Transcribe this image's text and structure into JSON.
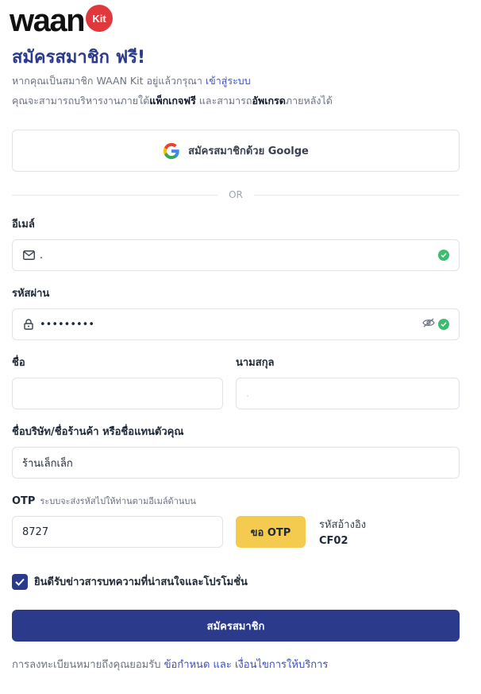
{
  "brand": {
    "wordmark": "waan",
    "badge": "Kit",
    "badge_color": "#e0383c"
  },
  "colors": {
    "primary": "#2b3a8a",
    "link": "#3b4ec4",
    "otp_button": "#f4cb4e",
    "success": "#3ebc6e"
  },
  "header": {
    "title": "สมัครสมาชิก ฟรี!",
    "line1_prefix": "หากคุณเป็นสมาชิก WAAN Kit อยู่แล้วกรุณา ",
    "line1_link": "เข้าสู่ระบบ",
    "line2_a": "คุณจะสามารถบริหารงานภายใต้",
    "line2_b": "แพ็กเกจฟรี",
    "line2_c": " และสามารถ",
    "line2_d": "อัพเกรด",
    "line2_e": "ภายหลังได้"
  },
  "google_button": {
    "label": "สมัครสมาชิกด้วย Goolge",
    "icon": "google-icon"
  },
  "divider_text": "OR",
  "email": {
    "label": "อีเมล์",
    "value": ".",
    "icon": "mail-icon",
    "valid": true
  },
  "password": {
    "label": "รหัสผ่าน",
    "value": "•••••••••",
    "icon": "lock-icon",
    "toggle_icon": "eye-off-icon",
    "valid": true
  },
  "first_name": {
    "label": "ชื่อ",
    "value": ""
  },
  "last_name": {
    "label": "นามสกุล",
    "value": "."
  },
  "company": {
    "label": "ชื่อบริษัท/ชื่อร้านค้า หรือชื่อแทนตัวคุณ",
    "value": "ร้านเล็กเล็ก"
  },
  "otp": {
    "label": "OTP",
    "hint": "ระบบจะส่งรหัสไปให้ท่านตามอีเมล์ด้านบน",
    "value": "8727",
    "button_label": "ขอ OTP",
    "ref_label": "รหัสอ้างอิง",
    "ref_code": "CF02"
  },
  "consent": {
    "label": "ยินดีรับข่าวสารบทความที่น่าสนใจและโปรโมชั่น",
    "checked": true
  },
  "submit_label": "สมัครสมาชิก",
  "terms": {
    "prefix": "การลงทะเบียนหมายถึงคุณยอมรับ ",
    "link": "ข้อกำหนด และ เงื่อนไขการให้บริการ"
  }
}
